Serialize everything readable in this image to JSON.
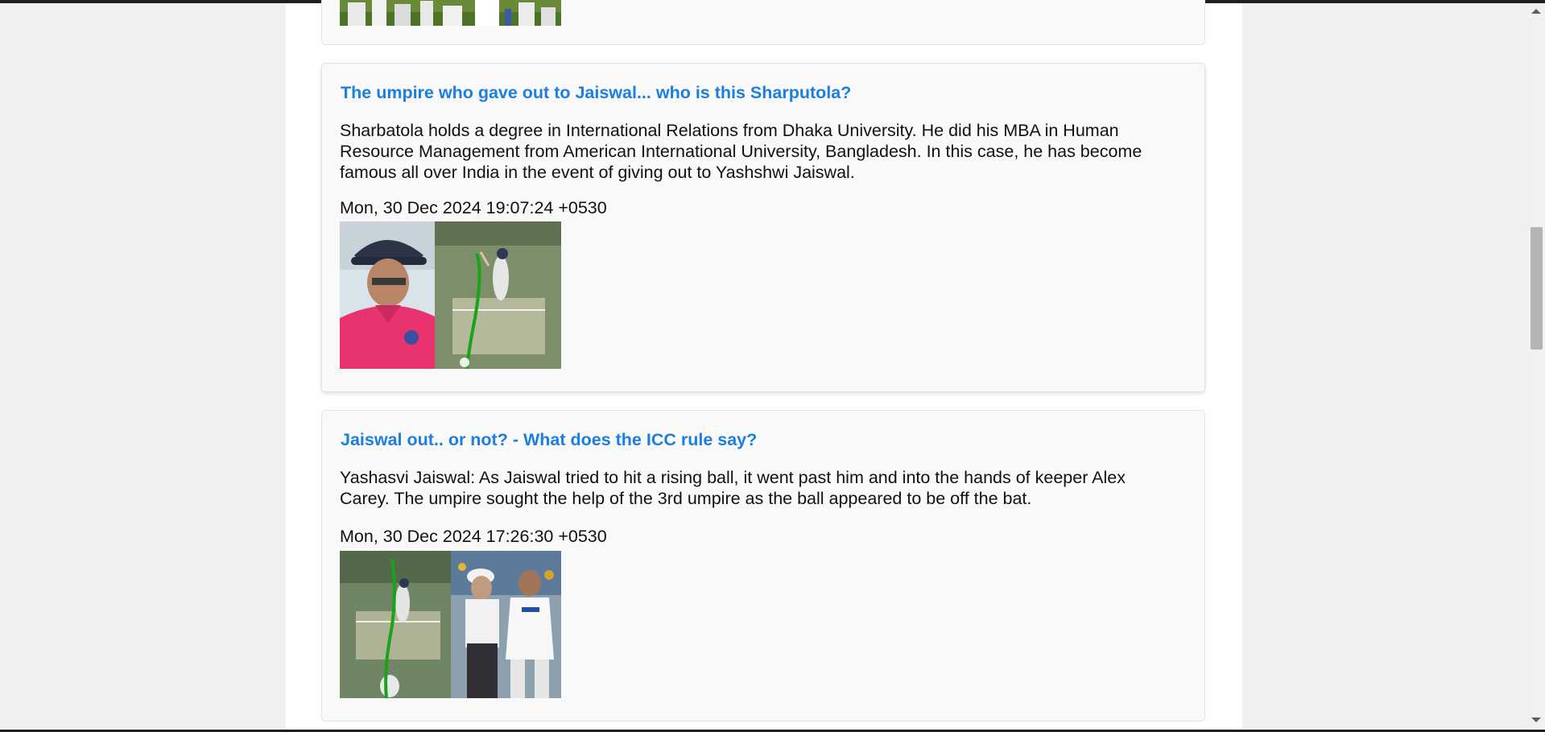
{
  "articles": [
    {
      "title": "",
      "description": "",
      "date": ""
    },
    {
      "title": "The umpire who gave out to Jaiswal... who is this Sharputola?",
      "description": "Sharbatola holds a degree in International Relations from Dhaka University. He did his MBA in Human Resource Management from American International University, Bangladesh. In this case, he has become famous all over India in the event of giving out to Yashshwi Jaiswal.",
      "date": "Mon, 30 Dec 2024 19:07:24 +0530",
      "image_icon": "umpire-and-replay-image"
    },
    {
      "title": "Jaiswal out.. or not? - What does the ICC rule say?",
      "description": "Yashasvi Jaiswal: As Jaiswal tried to hit a rising ball, it went past him and into the hands of keeper Alex Carey. The umpire sought the help of the 3rd umpire as the ball appeared to be off the bat.",
      "date": "Mon, 30 Dec 2024 17:26:30 +0530",
      "image_icon": "replay-and-umpire-image"
    }
  ],
  "colors": {
    "title_link": "#1a7fe0",
    "card_background": "#f9f9f9",
    "page_background": "#f0f0f0"
  }
}
